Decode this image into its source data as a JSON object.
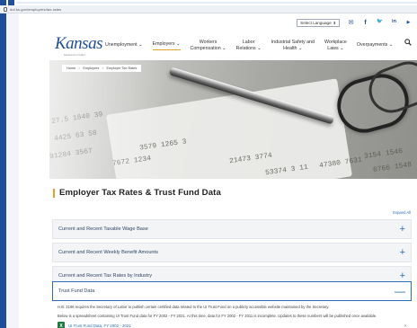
{
  "browser": {
    "url": "dol.ks.gov/employers/tax-rates"
  },
  "utility": {
    "language_label": "Select Language",
    "language_chevron": "⬍",
    "social": [
      {
        "name": "email-icon",
        "glyph": "✉"
      },
      {
        "name": "facebook-icon",
        "glyph": "f"
      },
      {
        "name": "twitter-icon",
        "glyph": "🐦"
      },
      {
        "name": "linkedin-icon",
        "glyph": "in"
      },
      {
        "name": "youtube-icon",
        "glyph": "▶"
      }
    ]
  },
  "logo": {
    "text": "Kansas",
    "sub": "Department of Labor"
  },
  "nav": {
    "items": [
      {
        "line1": "Unemployment",
        "line2": "",
        "chevron": "⌄",
        "active": false
      },
      {
        "line1": "Employers",
        "line2": "",
        "chevron": "⌄",
        "active": true
      },
      {
        "line1": "Workers",
        "line2": "Compensation",
        "chevron": "⌄",
        "active": false
      },
      {
        "line1": "Labor",
        "line2": "Relations",
        "chevron": "⌄",
        "active": false
      },
      {
        "line1": "Industrial Safety and",
        "line2": "Health",
        "chevron": "⌄",
        "active": false
      },
      {
        "line1": "Workplace",
        "line2": "Laws",
        "chevron": "⌄",
        "active": false
      },
      {
        "line1": "Overpayments",
        "line2": "",
        "chevron": "⌄",
        "active": false
      }
    ],
    "search_icon": "🔍"
  },
  "breadcrumb": {
    "items": [
      "Home",
      "Employers",
      "Employer Tax Rates"
    ],
    "separator": ">"
  },
  "page": {
    "title": "Employer Tax Rates & Trust Fund Data",
    "expand_all": "Expand All"
  },
  "accordions": [
    {
      "label": "Current and Recent Taxable Wage Base",
      "toggle": "+",
      "open": false
    },
    {
      "label": "Current and Recent Weekly Benefit Amounts",
      "toggle": "+",
      "open": false
    },
    {
      "label": "Current and Recent Tax Rates by Industry",
      "toggle": "+",
      "open": false
    },
    {
      "label": "Trust Fund Data",
      "toggle": "—",
      "open": true
    }
  ],
  "trust_fund": {
    "para1": "H.B. 2196 requires the Secretary of Labor to publish certain certified data related to the UI Trust Fund on a publicly accessible website maintained by the Secretary.",
    "para2": "Below is a spreadsheet containing UI Trust Fund data for FY 2002 - FY 2021. At this time, data for FY 2002 - FY 2011 is incomplete. Updates to these numbers will be published once available.",
    "file_icon": "X",
    "file_link": "UI Trust Fund Data, FY 2002 - 2021",
    "file_chevron": "›"
  },
  "colors": {
    "brand_blue": "#1f4f9a",
    "accent_gold": "#e2a229",
    "link_blue": "#2a6fb8"
  }
}
